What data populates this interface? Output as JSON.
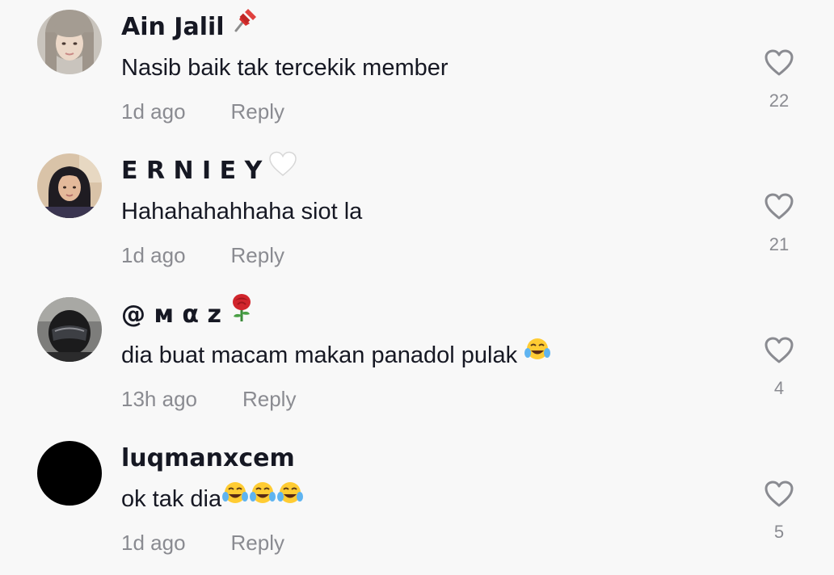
{
  "comments": [
    {
      "username": "Ain Jalil",
      "username_emoji": "pushpin-icon",
      "text": "Nasib baik tak tercekik member",
      "time": "1d ago",
      "reply_label": "Reply",
      "likes": "22"
    },
    {
      "username": "E R N I E Y",
      "username_emoji": "white-heart-icon",
      "text": "Hahahahahhaha siot la",
      "time": "1d ago",
      "reply_label": "Reply",
      "likes": "21"
    },
    {
      "username": "@ м α z",
      "username_emoji": "rose-icon",
      "text": "dia buat macam makan panadol pulak",
      "text_emoji": "tears-of-joy-icon",
      "time": "13h ago",
      "reply_label": "Reply",
      "likes": "4"
    },
    {
      "username": "luqmanxcem",
      "text": "ok tak dia",
      "text_emoji": "tears-of-joy-icon",
      "time": "1d ago",
      "reply_label": "Reply",
      "likes": "5"
    }
  ],
  "colors": {
    "background": "#f8f8f8",
    "primary_text": "#161823",
    "secondary_text": "#8a8b91",
    "icon_outline": "#8a8b91"
  }
}
